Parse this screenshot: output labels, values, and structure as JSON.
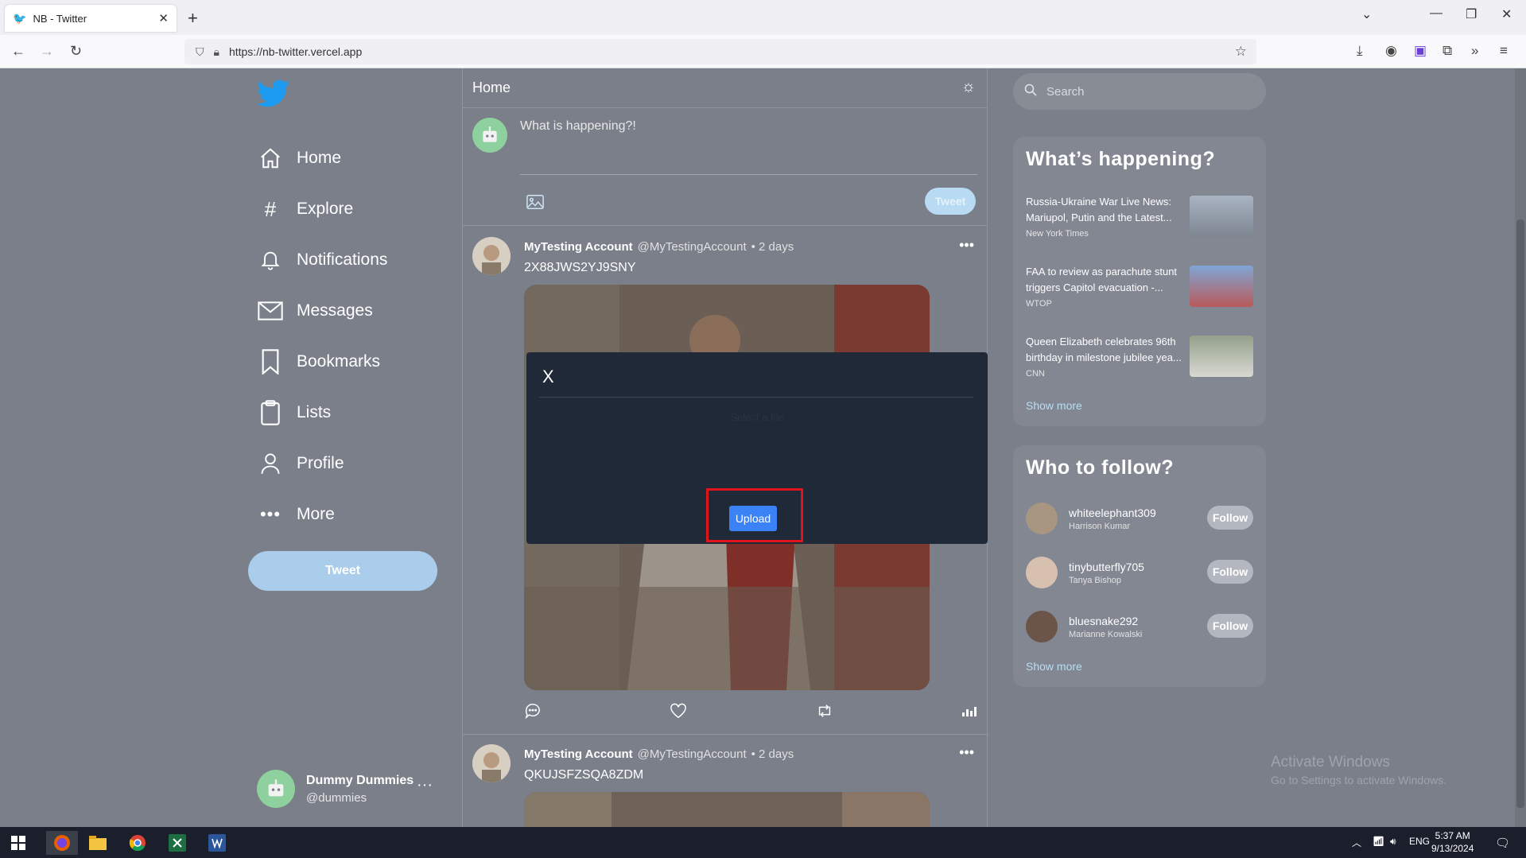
{
  "browser": {
    "tab_title": "NB - Twitter",
    "url": "https://nb-twitter.vercel.app"
  },
  "sidebar": {
    "items": [
      {
        "label": "Home",
        "icon": "home-icon"
      },
      {
        "label": "Explore",
        "icon": "hashtag-icon"
      },
      {
        "label": "Notifications",
        "icon": "bell-icon"
      },
      {
        "label": "Messages",
        "icon": "envelope-icon"
      },
      {
        "label": "Bookmarks",
        "icon": "bookmark-icon"
      },
      {
        "label": "Lists",
        "icon": "clipboard-icon"
      },
      {
        "label": "Profile",
        "icon": "person-icon"
      },
      {
        "label": "More",
        "icon": "dots-icon"
      }
    ],
    "tweet_button": "Tweet",
    "profile": {
      "name": "Dummy Dummies",
      "handle": "@dummies"
    }
  },
  "main": {
    "title": "Home",
    "composer_placeholder": "What is happening?!",
    "composer_tweet": "Tweet",
    "posts": [
      {
        "name": "MyTesting Account",
        "handle": "@MyTestingAccount",
        "time": "• 2 days",
        "text": "2X88JWS2YJ9SNY"
      },
      {
        "name": "MyTesting Account",
        "handle": "@MyTestingAccount",
        "time": "• 2 days",
        "text": "QKUJSFZSQA8ZDM"
      }
    ]
  },
  "right": {
    "search_placeholder": "Search",
    "happening_title": "What’s happening?",
    "news": [
      {
        "title": "Russia-Ukraine War Live News: Mariupol, Putin and the Latest...",
        "source": "New York Times"
      },
      {
        "title": "FAA to review as parachute stunt triggers Capitol evacuation -...",
        "source": "WTOP"
      },
      {
        "title": "Queen Elizabeth celebrates 96th birthday in milestone jubilee yea...",
        "source": "CNN"
      }
    ],
    "show_more": "Show more",
    "follow_title": "Who to follow?",
    "follow": [
      {
        "user": "whiteelephant309",
        "name": "Harrison Kumar",
        "btn": "Follow"
      },
      {
        "user": "tinybutterfly705",
        "name": "Tanya Bishop",
        "btn": "Follow"
      },
      {
        "user": "bluesnake292",
        "name": "Marianne Kowalski",
        "btn": "Follow"
      }
    ],
    "show_more_2": "Show more"
  },
  "modal": {
    "close": "X",
    "file_label": "Select a file",
    "upload": "Upload"
  },
  "watermark": {
    "title": "Activate Windows",
    "subtitle": "Go to Settings to activate Windows."
  },
  "taskbar": {
    "lang": "ENG",
    "time": "5:37 AM",
    "date": "9/13/2024"
  },
  "colors": {
    "accent": "#1d9bf0",
    "modal_bg": "#1f2937",
    "upload_btn": "#3b82f6",
    "highlight": "#e0141a"
  }
}
